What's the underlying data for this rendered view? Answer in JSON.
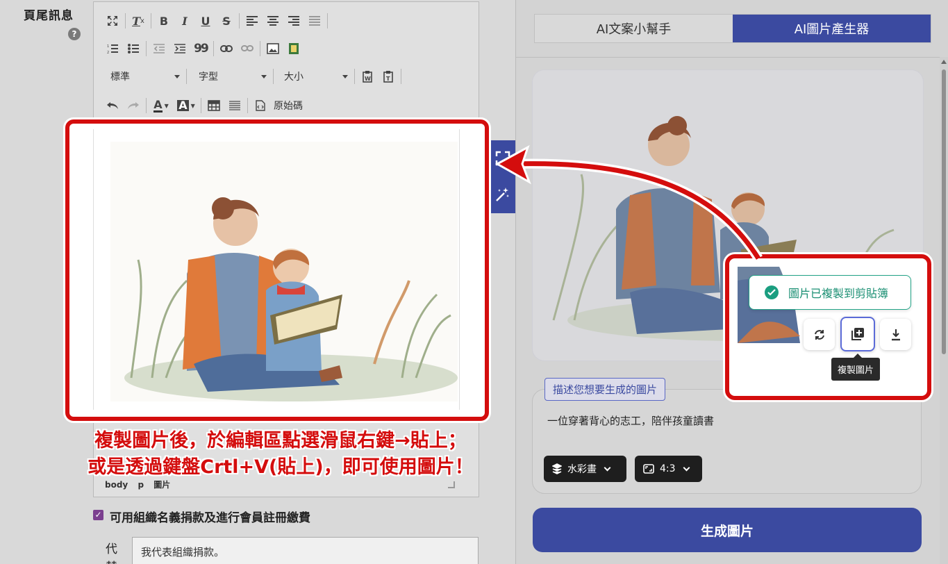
{
  "left_panel": {
    "field_label": "頁尾訊息",
    "help_icon_text": "?",
    "editor": {
      "toolbar": {
        "font_format": "標準",
        "font_family": "字型",
        "font_size": "大小",
        "source_label": "原始碼",
        "bold": "B",
        "italic": "I",
        "underline": "U",
        "strike": "S",
        "quote": "99",
        "text_color_letter": "A",
        "bg_color_letter": "A"
      },
      "status_path": [
        "body",
        "p",
        "圖片"
      ]
    },
    "checkbox_label": "可用組織名義捐款及進行會員註冊繳費",
    "representative_label_line1": "代",
    "representative_label_line2": "替",
    "representative_input_value": "我代表組織捐款。"
  },
  "right_panel": {
    "tabs": [
      "AI文案小幫手",
      "AI圖片產生器"
    ],
    "active_tab": 1,
    "prompt_chip": "描述您想要生成的圖片",
    "prompt_text": "一位穿著背心的志工，陪伴孩童讀書",
    "style_option": "水彩畫",
    "ratio_option": "4:3",
    "generate_button": "生成圖片",
    "toast": "圖片已複製到剪貼簿",
    "tooltip": "複製圖片"
  },
  "annotation": {
    "line1": "複製圖片後，於編輯區點選滑鼠右鍵→貼上；",
    "line2": "或是透過鍵盤Crtl+V(貼上)，即可使用圖片！"
  },
  "colors": {
    "accent": "#3b4aa0",
    "highlight": "#d40d0d",
    "success": "#1a9e80"
  }
}
